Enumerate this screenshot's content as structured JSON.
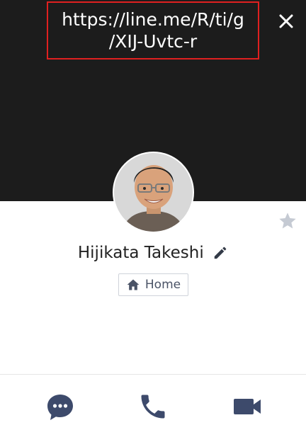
{
  "header": {
    "url_line1": "https://line.me/R/ti/g",
    "url_line2": "/XIJ-Uvtc-r",
    "close_icon": "close-icon"
  },
  "profile": {
    "name": "Hijikata Takeshi",
    "home_label": "Home",
    "avatar_icon": "profile-photo",
    "favorite_icon": "star-icon",
    "edit_icon": "pencil-icon"
  },
  "actions": {
    "chat_icon": "chat-icon",
    "call_icon": "phone-icon",
    "video_icon": "video-camera-icon"
  },
  "colors": {
    "header_bg": "#1c1c1c",
    "highlight_border": "#e02020",
    "icon_dark": "#3d4a6b",
    "star_gray": "#c5cad3"
  }
}
